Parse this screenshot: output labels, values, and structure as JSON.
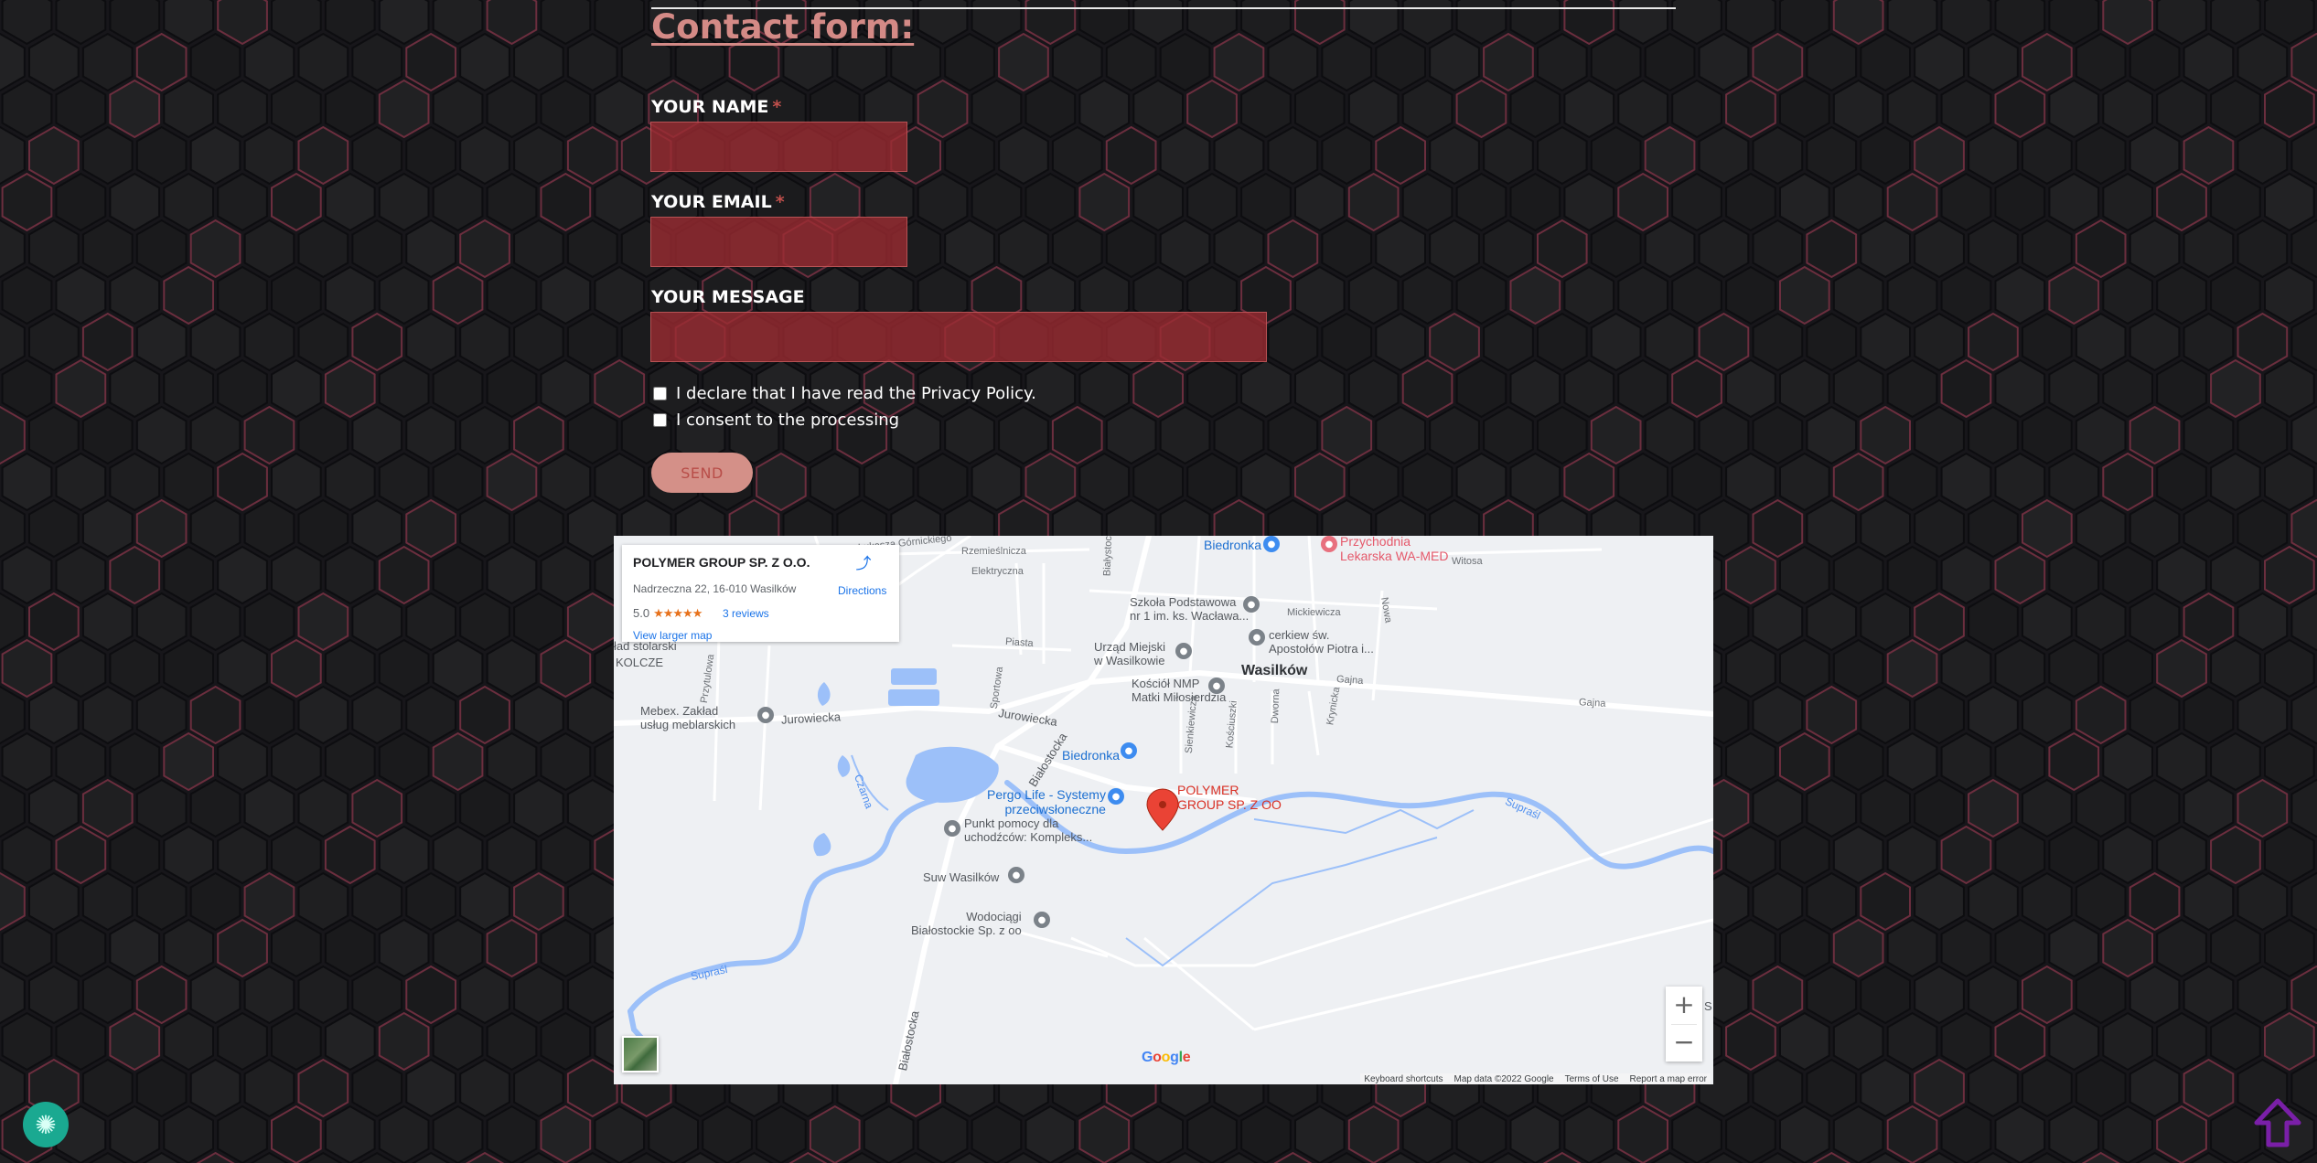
{
  "form": {
    "title": "Contact form:",
    "name_label": "YOUR NAME",
    "email_label": "YOUR EMAIL",
    "message_label": "YOUR MESSAGE",
    "required_mark": "*",
    "name_value": "",
    "email_value": "",
    "message_value": "",
    "privacy_label": "I declare that I have read the Privacy Policy.",
    "privacy_checked": false,
    "consent_label": "I consent to the processing",
    "consent_checked": false,
    "send_label": "SEND"
  },
  "map": {
    "info_card": {
      "name": "POLYMER GROUP SP. Z O.O.",
      "address": "Nadrzeczna 22, 16-010 Wasilków",
      "rating": "5.0",
      "stars": "★★★★★",
      "reviews": "3 reviews",
      "view_larger": "View larger map",
      "directions": "Directions"
    },
    "labels": {
      "lukasza": "Łukasza Górnickiego",
      "rzemieslnicza": "Rzemieślnicza",
      "elektryczna": "Elektryczna",
      "piasta": "Piasta",
      "sportowa": "Sportowa",
      "przytulowa": "Przytulowa",
      "biala": "Białystocka",
      "stolarski": "ład stolarski",
      "kolcze": "KOLCZE",
      "mebex": "Mebex. Zakład\nusług meblarskich",
      "jurowiecka1": "Jurowiecka",
      "jurowiecka2": "Jurowiecka",
      "czarna": "Czarna",
      "bialostocka_n": "Białostocka",
      "bialostocka_s": "Białostocka",
      "biedronka1": "Biedronka",
      "biedronka2": "Biedronka",
      "przychodnia": "Przychodnia\nLekarska WA-MED",
      "witosa": "Witosa",
      "szkola": "Szkoła Podstawowa\nnr 1 im. ks. Wacława...",
      "mickiewicza": "Mickiewicza",
      "nowa": "Nowa",
      "cerkiew": "cerkiew św.\nApostołów Piotra i...",
      "urzad": "Urząd Miejski\nw Wasilkowie",
      "kosciol": "Kościół NMP\nMatki Miłosierdzia",
      "wasilkow": "Wasilków",
      "gajna1": "Gajna",
      "gajna2": "Gajna",
      "sienkiewicza": "Sienkiewicza",
      "kosciuszki": "Kościuszki",
      "dworna": "Dworna",
      "krynicka": "Krynicka",
      "polymer": "POLYMER\nGROUP SP. Z OO",
      "pergo": "Pergo Life - Systemy\nprzeciwsłoneczne",
      "punkt": "Punkt pomocy dla\nuchodźców: Kompleks...",
      "suw": "Suw Wasilków",
      "wodociagi": "Wodociągi\nBiałostockie Sp. z oo",
      "suprasl1": "Supraśl",
      "suprasl2": "Supraśl",
      "edge_s": "S"
    },
    "zoom_in": "+",
    "zoom_out": "−",
    "google": "Google",
    "attribution": {
      "shortcuts": "Keyboard shortcuts",
      "map_data": "Map data ©2022 Google",
      "terms": "Terms of Use",
      "report": "Report a map error"
    }
  },
  "colors": {
    "accent": "#d48a86",
    "field_bg": "#9e2c32",
    "send_bg": "#d49088",
    "chat_bg": "#1aa991",
    "scroll_top": "#7a1fa8",
    "water": "#9cc0f9"
  },
  "icons": {
    "chat": "chat-bubble-icon",
    "scroll_top": "arrow-up-icon",
    "directions": "directions-icon",
    "marker": "map-marker-icon"
  }
}
